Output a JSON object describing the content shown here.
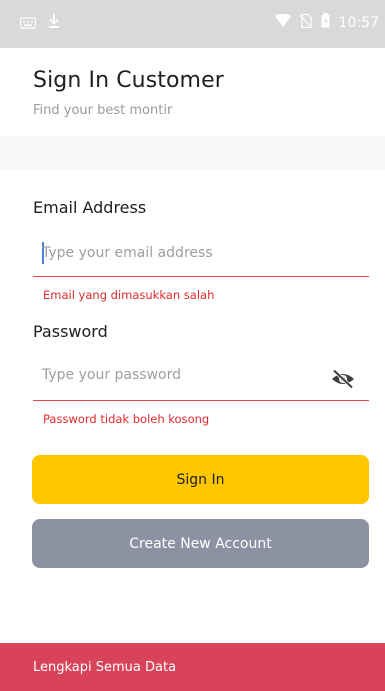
{
  "status_bar": {
    "time": "10:57",
    "icons": [
      "keyboard-icon",
      "download-icon",
      "wifi-icon",
      "no-sim-icon",
      "battery-icon"
    ],
    "background": "#d9d9d9"
  },
  "header": {
    "title": "Sign In Customer",
    "subtitle": "Find your best montir"
  },
  "form": {
    "email": {
      "label": "Email Address",
      "placeholder": "Type your email address",
      "error": "Email yang dimasukkan salah"
    },
    "password": {
      "label": "Password",
      "placeholder": "Type your password",
      "error": "Password tidak boleh kosong",
      "toggle_icon": "eye-off-icon"
    }
  },
  "buttons": {
    "sign_in": "Sign In",
    "create_account": "Create New Account"
  },
  "snackbar": {
    "message": "Lengkapi Semua Data"
  },
  "colors": {
    "primary": "#fec700",
    "secondary": "#8d92a3",
    "error": "#e02b2b",
    "snackbar": "#d9435a"
  }
}
